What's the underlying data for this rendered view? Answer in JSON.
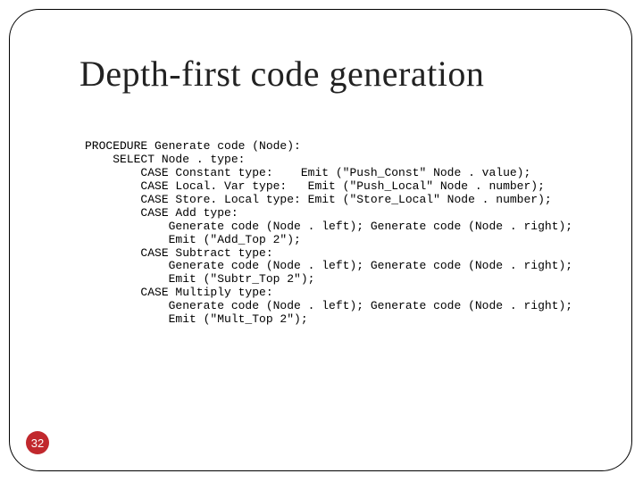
{
  "slide": {
    "title": "Depth-first code generation",
    "page_number": "32",
    "code": "PROCEDURE Generate code (Node):\n    SELECT Node . type:\n        CASE Constant type:    Emit (\"Push_Const\" Node . value);\n        CASE Local. Var type:   Emit (\"Push_Local\" Node . number);\n        CASE Store. Local type: Emit (\"Store_Local\" Node . number);\n        CASE Add type:\n            Generate code (Node . left); Generate code (Node . right);\n            Emit (\"Add_Top 2\");\n        CASE Subtract type:\n            Generate code (Node . left); Generate code (Node . right);\n            Emit (\"Subtr_Top 2\");\n        CASE Multiply type:\n            Generate code (Node . left); Generate code (Node . right);\n            Emit (\"Mult_Top 2\");"
  }
}
